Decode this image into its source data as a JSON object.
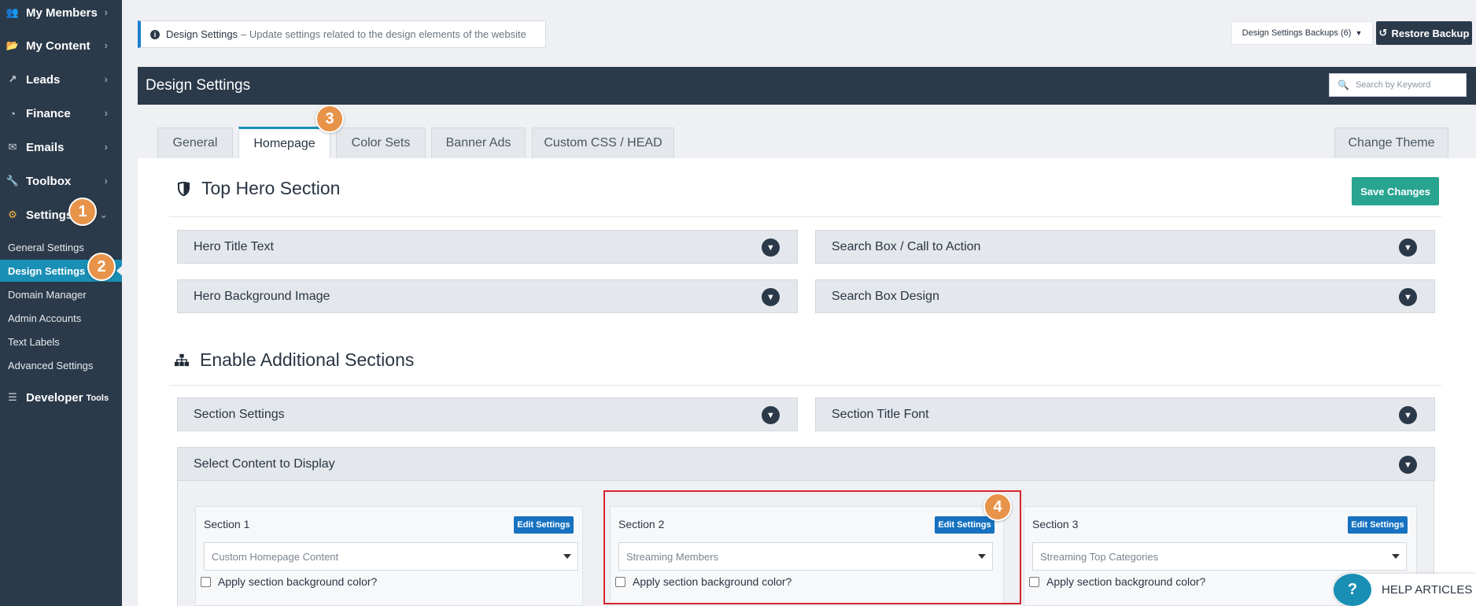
{
  "sidebar": {
    "nav": [
      {
        "label": "My Members",
        "icon": "users-icon",
        "glyph": "👥"
      },
      {
        "label": "My Content",
        "icon": "folder-icon",
        "glyph": "📂"
      },
      {
        "label": "Leads",
        "icon": "share-icon",
        "glyph": "↗"
      },
      {
        "label": "Finance",
        "icon": "pie-chart-icon",
        "glyph": "◔"
      },
      {
        "label": "Emails",
        "icon": "inbox-icon",
        "glyph": "✉"
      },
      {
        "label": "Toolbox",
        "icon": "wrench-icon",
        "glyph": "🔧"
      },
      {
        "label": "Settings",
        "icon": "gear-icon",
        "glyph": "⚙"
      }
    ],
    "settings_sub": [
      {
        "label": "General Settings"
      },
      {
        "label": "Design Settings"
      },
      {
        "label": "Domain Manager"
      },
      {
        "label": "Admin Accounts"
      },
      {
        "label": "Text Labels"
      },
      {
        "label": "Advanced Settings"
      }
    ],
    "developer": {
      "label": "Developer",
      "small": "Tools",
      "icon": "sliders-icon"
    }
  },
  "badges": [
    "1",
    "2",
    "3",
    "4"
  ],
  "info_bar": {
    "title": "Design Settings",
    "description": "– Update settings related to the design elements of the website"
  },
  "backups_label": "Design Settings Backups (6)",
  "restore_label": "Restore Backup",
  "panel": {
    "title": "Design Settings",
    "search_placeholder": "Search by Keyword"
  },
  "tabs": [
    {
      "label": "General",
      "active": false
    },
    {
      "label": "Homepage",
      "active": true
    },
    {
      "label": "Color Sets",
      "active": false
    },
    {
      "label": "Banner Ads",
      "active": false
    },
    {
      "label": "Custom CSS / HEAD",
      "active": false
    }
  ],
  "change_theme_label": "Change Theme",
  "top_hero": {
    "title": "Top Hero Section",
    "save_label": "Save Changes",
    "accordions": [
      "Hero Title Text",
      "Search Box / Call to Action",
      "Hero Background Image",
      "Search Box Design"
    ]
  },
  "additional": {
    "title": "Enable Additional Sections",
    "accordions": [
      "Section Settings",
      "Section Title Font",
      "Select Content to Display"
    ]
  },
  "sections": [
    {
      "name": "Section 1",
      "edit": "Edit Settings",
      "value": "Custom Homepage Content",
      "checkbox": "Apply section background color?"
    },
    {
      "name": "Section 2",
      "edit": "Edit Settings",
      "value": "Streaming Members",
      "checkbox": "Apply section background color?"
    },
    {
      "name": "Section 3",
      "edit": "Edit Settings",
      "value": "Streaming Top Categories",
      "checkbox": "Apply section background color?"
    }
  ],
  "help_label": "HELP ARTICLES",
  "colors": {
    "sidebar_bg": "#2b3a4a",
    "accent_teal": "#1a8fb5",
    "save_green": "#28a490",
    "badge_orange": "#e8934a",
    "highlight_red": "#d6252c"
  }
}
